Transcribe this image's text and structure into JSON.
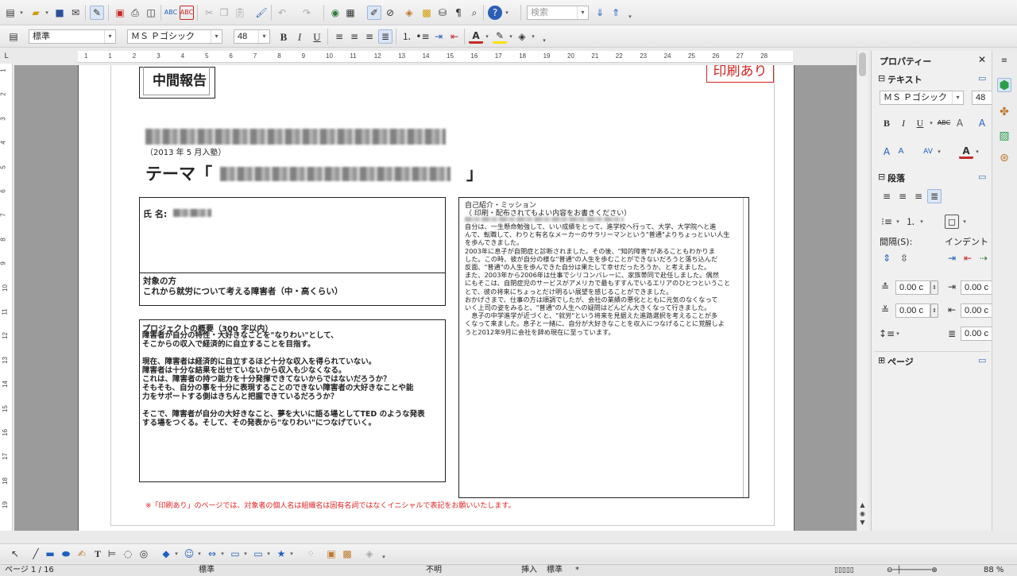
{
  "toolbar1": {
    "search_placeholder": "検索"
  },
  "toolbar2": {
    "paragraph_style": "標準",
    "font_name": "ＭＳ Ｐゴシック",
    "font_size": "48"
  },
  "ruler": {
    "h_ticks": [
      "1",
      "1",
      "2",
      "3",
      "4",
      "5",
      "6",
      "7",
      "8",
      "9",
      "10",
      "11",
      "12",
      "13",
      "14",
      "15",
      "16",
      "17",
      "18",
      "19",
      "20",
      "21",
      "22",
      "23",
      "24",
      "25",
      "26",
      "27",
      "28"
    ],
    "v_ticks": [
      "1",
      "2",
      "3",
      "4",
      "5",
      "6",
      "7",
      "8",
      "9",
      "10",
      "11",
      "12",
      "13",
      "14",
      "15",
      "16",
      "17",
      "18",
      "19"
    ]
  },
  "document": {
    "header_box": "中間報告",
    "stamp": "印刷あり",
    "enroll": "（2013 年 5 月入塾）",
    "theme_prefix": "テーマ「",
    "theme_suffix": "」",
    "name_label": "氏 名:",
    "target_label": "対象の方",
    "target_text": "これから就労について考える障害者（中・高くらい）",
    "summary_label": "プロジェクトの概要（300 字以内）",
    "summary_lines": [
      "障害者が自分の特性・大好きなことを\"なりわい\"として、",
      "そこからの収入で経済的に自立することを目指す。",
      "",
      "現在、障害者は経済的に自立するほど十分な収入を得られていない。",
      "障害者は十分な結果を出せていないから収入も少なくなる。",
      "これは、障害者の持つ能力を十分発揮できてないからではないだろうか？",
      "そもそも、自分の事を十分に表現することのできない障害者の大好きなことや能",
      "力をサポートする側はきちんと把握できているだろうか？",
      "",
      "そこで、障害者が自分の大好きなこと、夢を大いに語る場としてTED のような発表",
      "する場をつくる。そして、その発表から\"なりわい\"につなげていく。"
    ],
    "intro_label": "自己紹介・ミッション",
    "intro_note": "（ 印刷・配布されてもよい内容をお書きください）",
    "intro_lines": [
      "自分は、一生懸命勉強して、いい成績をとって、進学校へ行って、大学、大学院へと進",
      "んで、転職して、わりと有名なメーカーのサラリーマンという\"普通\"よりちょっといい人生",
      "を歩んできました。",
      "2003年に息子が自閉症と診断されました。その後、\"知的障害\"があることもわかりま",
      "した。この時、彼が自分の様な\"普通\"の人生を歩むことができないだろうと落ち込んだ",
      "反面、\"普通\"の人生を歩んできた自分は果たして幸せだったろうか、と考えました。",
      "また、2003年から2006年は仕事でシリコンバレーに、家族帯同で赴任しました。偶然",
      "にもそこは、自閉症児のサービスがアメリカで最もすすんでいるエリアのひとつということ",
      "とで、彼の将来にちょっとだけ明るい展望を感じることができました。",
      "おかげさまで、仕事の方は順調でしたが、会社の業績の悪化とともに元気のなくなって",
      "いく上司の姿をみると、\"普通\"の人生への疑問はどんどん大きくなって行きました。",
      "　息子の中学進学が近づくと、\"就労\"という将来を見据えた進路選択を考えることが多",
      "くなって来ました。息子と一緒に、自分が大好きなことを収入につなげることに覚醒しよ",
      "うと2012年9月に会社を辞め現在に至っています。"
    ],
    "footnote": "※「印刷あり」のページでは、対象者の個人名は組織名は固有名詞ではなくイニシャルで表記をお願いいたします。"
  },
  "sidebar": {
    "title": "プロパティー",
    "text_section": "テキスト",
    "font_name": "ＭＳ Ｐゴシック",
    "font_size": "48",
    "paragraph_section": "段落",
    "spacing_label": "間隔(S):",
    "indent_label": "インデント",
    "val1": "0.00 c",
    "val2": "0.00 c",
    "val3": "0.00 c",
    "val4": "0.00 c",
    "val5": "0.00 c",
    "page_section": "ページ"
  },
  "statusbar": {
    "page": "ページ 1 / 16",
    "style": "標準",
    "language": "不明",
    "insert_mode": "挿入",
    "selection_mode": "標準",
    "modified": "*",
    "zoom": "88 %"
  },
  "colors": {
    "stamp_red": "#d22222",
    "footnote_red": "#e02020",
    "accent_blue": "#1f5fbf"
  }
}
